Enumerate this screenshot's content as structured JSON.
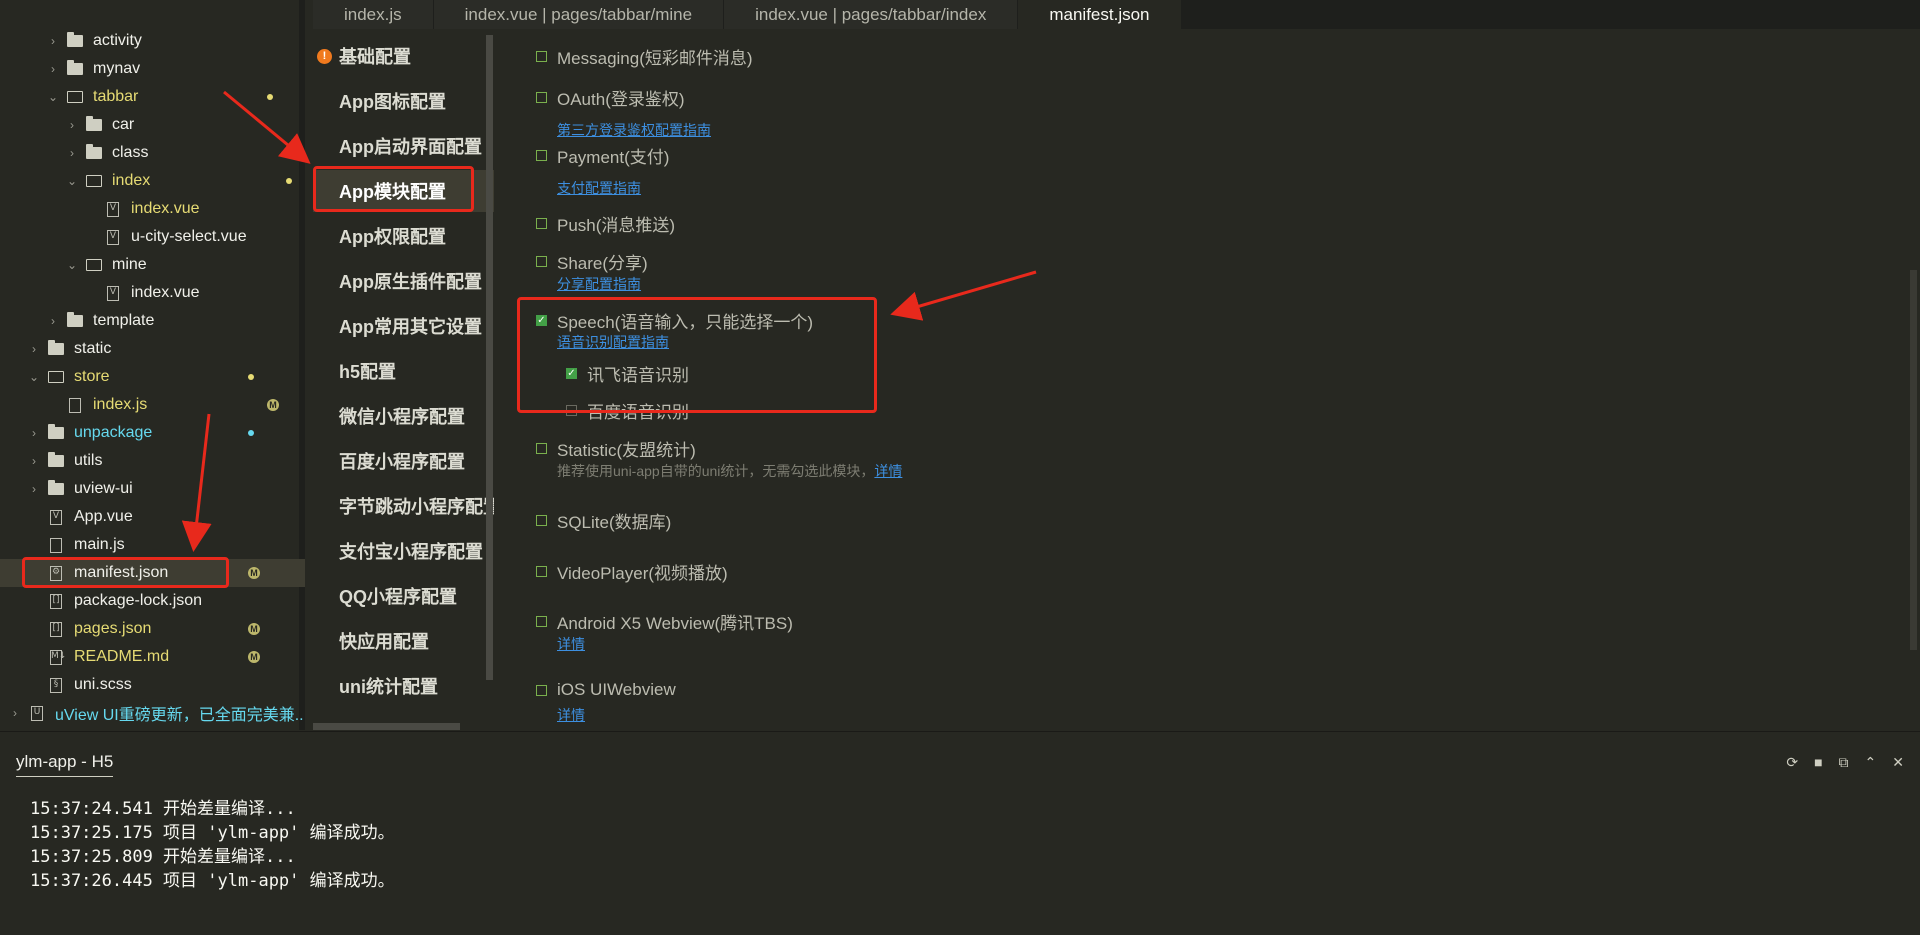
{
  "file_tree": [
    {
      "label": "activity",
      "kind": "folder",
      "state": "collapsed",
      "depth": 2,
      "color": "white"
    },
    {
      "label": "mynav",
      "kind": "folder",
      "state": "collapsed",
      "depth": 2,
      "color": "white"
    },
    {
      "label": "tabbar",
      "kind": "folder",
      "state": "expanded",
      "depth": 2,
      "color": "yellow",
      "marker": "dot"
    },
    {
      "label": "car",
      "kind": "folder",
      "state": "collapsed",
      "depth": 3,
      "color": "white"
    },
    {
      "label": "class",
      "kind": "folder",
      "state": "collapsed",
      "depth": 3,
      "color": "white"
    },
    {
      "label": "index",
      "kind": "folder",
      "state": "expanded",
      "depth": 3,
      "color": "yellow",
      "marker": "dot"
    },
    {
      "label": "index.vue",
      "kind": "vue-file",
      "depth": 4,
      "color": "yellow",
      "marker": "M"
    },
    {
      "label": "u-city-select.vue",
      "kind": "vue-file",
      "depth": 4,
      "color": "white"
    },
    {
      "label": "mine",
      "kind": "folder",
      "state": "expanded",
      "depth": 3,
      "color": "white"
    },
    {
      "label": "index.vue",
      "kind": "vue-file",
      "depth": 4,
      "color": "white"
    },
    {
      "label": "template",
      "kind": "folder",
      "state": "collapsed",
      "depth": 2,
      "color": "white"
    },
    {
      "label": "static",
      "kind": "folder",
      "state": "collapsed",
      "depth": 1,
      "color": "white"
    },
    {
      "label": "store",
      "kind": "folder",
      "state": "expanded",
      "depth": 1,
      "color": "yellow",
      "marker": "dot"
    },
    {
      "label": "index.js",
      "kind": "js-file",
      "depth": 2,
      "color": "yellow",
      "marker": "M"
    },
    {
      "label": "unpackage",
      "kind": "folder",
      "state": "collapsed",
      "depth": 1,
      "color": "blue",
      "marker": "dot-blue"
    },
    {
      "label": "utils",
      "kind": "folder",
      "state": "collapsed",
      "depth": 1,
      "color": "white"
    },
    {
      "label": "uview-ui",
      "kind": "folder",
      "state": "collapsed",
      "depth": 1,
      "color": "white"
    },
    {
      "label": "App.vue",
      "kind": "vue-file",
      "depth": 1,
      "color": "white"
    },
    {
      "label": "main.js",
      "kind": "js-file",
      "depth": 1,
      "color": "white"
    },
    {
      "label": "manifest.json",
      "kind": "settings-file",
      "depth": 1,
      "color": "white",
      "marker": "M",
      "selected": true
    },
    {
      "label": "package-lock.json",
      "kind": "json-file",
      "depth": 1,
      "color": "white"
    },
    {
      "label": "pages.json",
      "kind": "json-file",
      "depth": 1,
      "color": "yellow",
      "marker": "M"
    },
    {
      "label": "README.md",
      "kind": "md-file",
      "depth": 1,
      "color": "yellow",
      "marker": "M"
    },
    {
      "label": "uni.scss",
      "kind": "scss-file",
      "depth": 1,
      "color": "white"
    },
    {
      "label": "uView UI重磅更新，已全面完美兼...",
      "kind": "plugin",
      "state": "collapsed",
      "depth": 0,
      "color": "blue"
    }
  ],
  "tabs": [
    {
      "label": "index.js",
      "active": false
    },
    {
      "label": "index.vue | pages/tabbar/mine",
      "active": false
    },
    {
      "label": "index.vue | pages/tabbar/index",
      "active": false
    },
    {
      "label": "manifest.json",
      "active": true
    }
  ],
  "settings_nav": [
    {
      "label": "基础配置",
      "warning": true
    },
    {
      "label": "App图标配置"
    },
    {
      "label": "App启动界面配置"
    },
    {
      "label": "App模块配置",
      "active": true
    },
    {
      "label": "App权限配置"
    },
    {
      "label": "App原生插件配置"
    },
    {
      "label": "App常用其它设置"
    },
    {
      "label": "h5配置"
    },
    {
      "label": "微信小程序配置"
    },
    {
      "label": "百度小程序配置"
    },
    {
      "label": "字节跳动小程序配置"
    },
    {
      "label": "支付宝小程序配置"
    },
    {
      "label": "QQ小程序配置"
    },
    {
      "label": "快应用配置"
    },
    {
      "label": "uni统计配置"
    }
  ],
  "modules": {
    "messaging": {
      "label": "Messaging(短彩邮件消息)",
      "checked": false
    },
    "oauth": {
      "label": "OAuth(登录鉴权)",
      "checked": false,
      "link": "第三方登录鉴权配置指南"
    },
    "payment": {
      "label": "Payment(支付)",
      "checked": false,
      "link": "支付配置指南"
    },
    "push": {
      "label": "Push(消息推送)",
      "checked": false
    },
    "share": {
      "label": "Share(分享)",
      "checked": false,
      "link": "分享配置指南"
    },
    "speech": {
      "label": "Speech(语音输入，只能选择一个)",
      "checked": true,
      "link": "语音识别配置指南",
      "options": [
        {
          "label": "讯飞语音识别",
          "checked": true
        },
        {
          "label": "百度语音识别",
          "checked": false
        }
      ]
    },
    "statistic": {
      "label": "Statistic(友盟统计)",
      "checked": false,
      "note": "推荐使用uni-app自带的uni统计，无需勾选此模块，",
      "note_link": "详情"
    },
    "sqlite": {
      "label": "SQLite(数据库)",
      "checked": false
    },
    "videoplayer": {
      "label": "VideoPlayer(视频播放)",
      "checked": false
    },
    "x5": {
      "label": "Android X5 Webview(腾讯TBS)",
      "checked": false,
      "link": "详情"
    },
    "uiwebview": {
      "label": "iOS UIWebview",
      "checked": false,
      "link": "详情"
    }
  },
  "console": {
    "tab_label": "ylm-app - H5",
    "tools": [
      "restart-icon",
      "stop-icon",
      "open-external-icon",
      "collapse-icon",
      "clear-icon"
    ],
    "lines": [
      "15:37:24.541 开始差量编译...",
      "15:37:25.175 项目 'ylm-app' 编译成功。",
      "15:37:25.809 开始差量编译...",
      "15:37:26.445 项目 'ylm-app' 编译成功。"
    ]
  },
  "colors": {
    "background": "#272822",
    "highlight": "#3e3d32",
    "annotation_red": "#e8291c",
    "link_blue": "#3d8fe0",
    "modified_yellow": "#e6db74",
    "checkbox_green": "#43a047"
  }
}
